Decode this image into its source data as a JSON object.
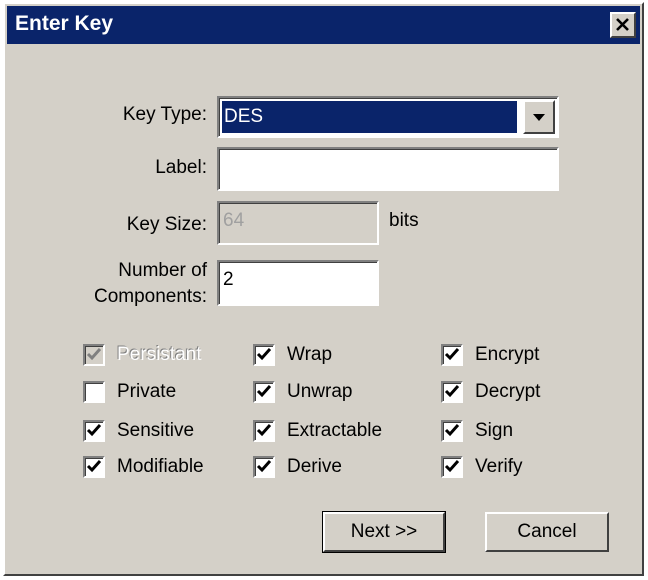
{
  "dialog": {
    "title": "Enter Key",
    "close_icon": "close-x-icon"
  },
  "form": {
    "key_type_label": "Key Type:",
    "key_type_value": "DES",
    "label_label": "Label:",
    "label_value": "",
    "key_size_label": "Key Size:",
    "key_size_value": "64",
    "key_size_unit": "bits",
    "num_components_label_line1": "Number of",
    "num_components_label_line2": "Components:",
    "num_components_value": "2"
  },
  "checkboxes": [
    {
      "label": "Persistant",
      "checked": true,
      "disabled": true
    },
    {
      "label": "Wrap",
      "checked": true,
      "disabled": false
    },
    {
      "label": "Encrypt",
      "checked": true,
      "disabled": false
    },
    {
      "label": "Private",
      "checked": false,
      "disabled": false
    },
    {
      "label": "Unwrap",
      "checked": true,
      "disabled": false
    },
    {
      "label": "Decrypt",
      "checked": true,
      "disabled": false
    },
    {
      "label": "Sensitive",
      "checked": true,
      "disabled": false
    },
    {
      "label": "Extractable",
      "checked": true,
      "disabled": false
    },
    {
      "label": "Sign",
      "checked": true,
      "disabled": false
    },
    {
      "label": "Modifiable",
      "checked": true,
      "disabled": false
    },
    {
      "label": "Derive",
      "checked": true,
      "disabled": false
    },
    {
      "label": "Verify",
      "checked": true,
      "disabled": false
    }
  ],
  "buttons": {
    "next_label": "Next >>",
    "cancel_label": "Cancel"
  },
  "colors": {
    "titlebar": "#0a246a",
    "face": "#d4d0c8",
    "selection": "#0a246a"
  }
}
